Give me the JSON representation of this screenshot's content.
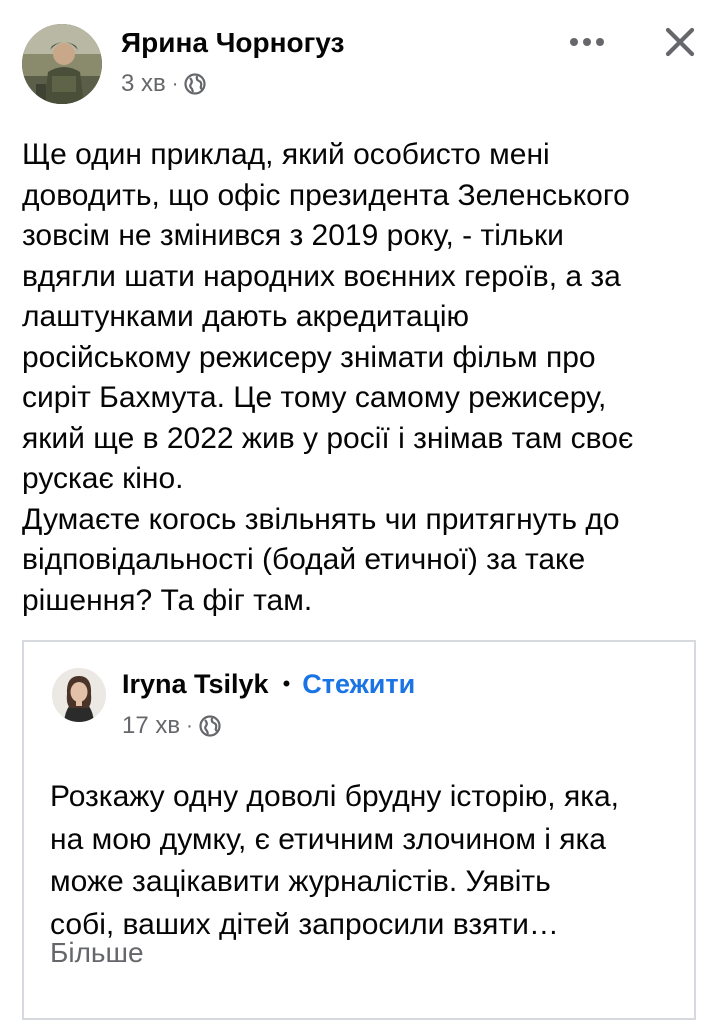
{
  "post": {
    "author_name": "Ярина Чорногуз",
    "time": "3 хв",
    "meta_separator": "·",
    "privacy_icon": "globe-icon",
    "more_icon": "more-horizontal-icon",
    "close_icon": "close-icon",
    "text": "Ще один приклад, який особисто мені\nдоводить, що офіс президента Зеленського\nзовсім не змінився з 2019 року, - тільки\nвдягли шати народних воєнних героїв, а за\nлаштунками дають акредитацію\nросійському режисеру знімати фільм про\nсиріт Бахмута. Це тому самому режисеру,\nякий ще в 2022 жив у росії і знімав там своє\nрускає кіно.\nДумаєте когось звільнять чи притягнуть до\nвідповідальності (бодай етичної) за таке\nрішення? Та фіг там."
  },
  "shared_post": {
    "author_name": "Iryna Tsilyk",
    "name_separator": "•",
    "follow_label": "Стежити",
    "time": "17 хв",
    "meta_separator": "·",
    "privacy_icon": "globe-icon",
    "text": "Розкажу одну доволі брудну історію, яка,\nна мою думку, є етичним злочином і яка\nможе зацікавити журналістів. Уявіть\nсобі, ваших дітей запросили взяти…",
    "more_label": "Більше"
  },
  "colors": {
    "text_primary": "#050505",
    "text_secondary": "#65676b",
    "link_blue": "#1b74e4",
    "card_border": "#d6d9dd"
  }
}
